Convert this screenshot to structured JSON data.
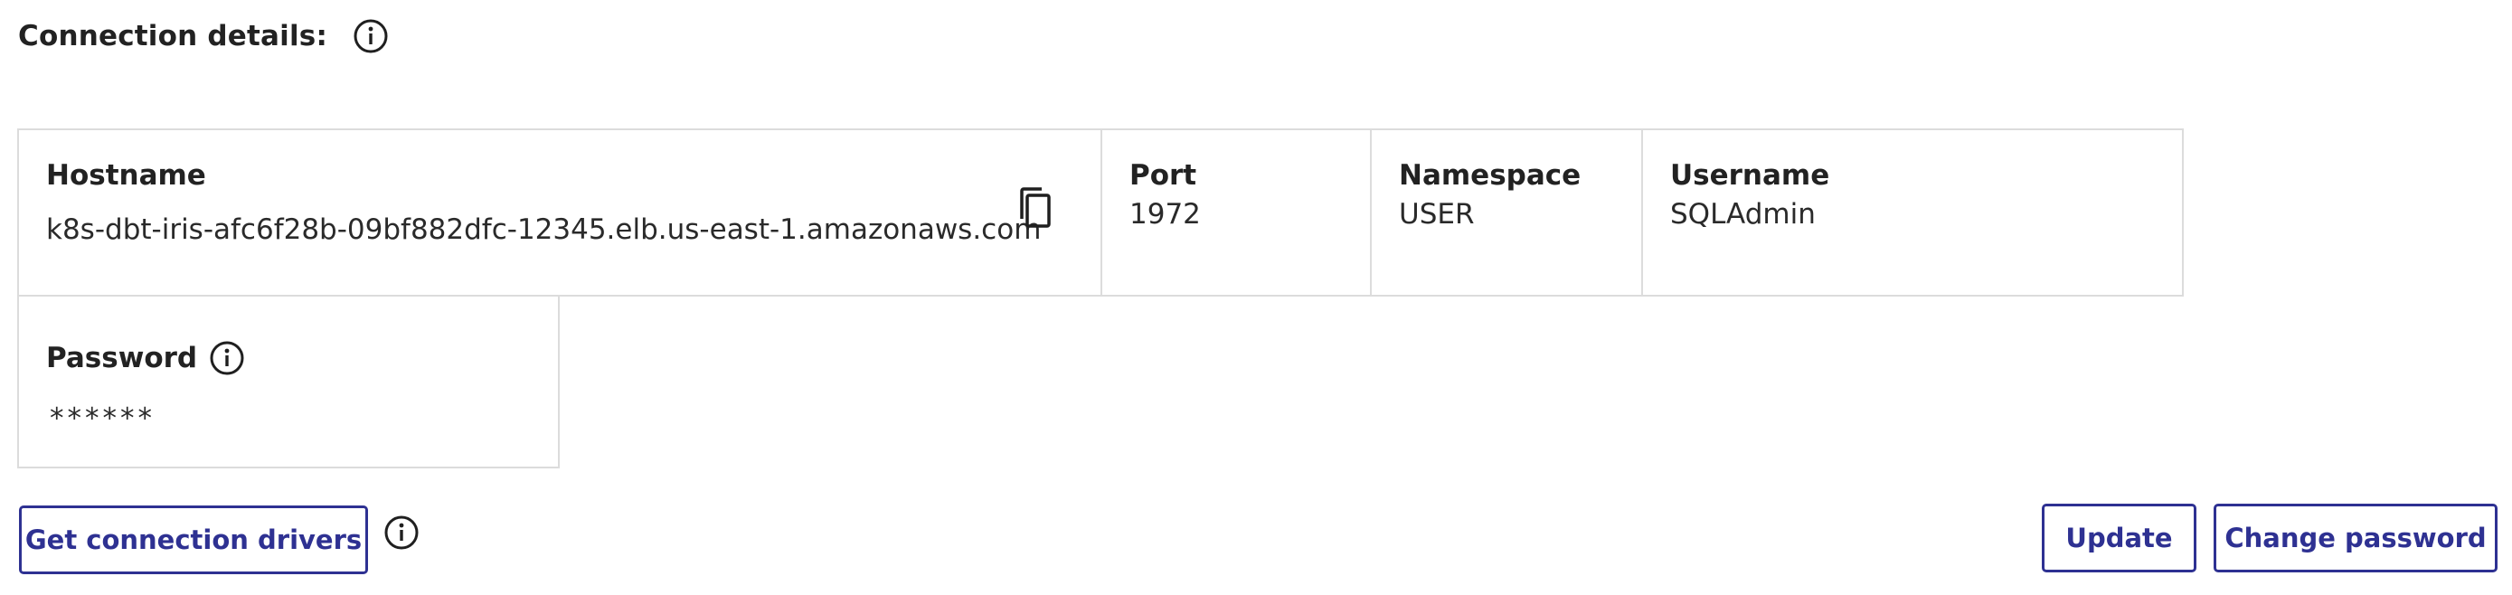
{
  "header": {
    "title": "Connection details:",
    "info_icon": "info-circle-icon"
  },
  "fields": {
    "hostname": {
      "label": "Hostname",
      "value": "k8s-dbt-iris-afc6f28b-09bf882dfc-12345.elb.us-east-1.amazonaws.com",
      "copy_icon": "copy-icon"
    },
    "port": {
      "label": "Port",
      "value": "1972"
    },
    "namespace": {
      "label": "Namespace",
      "value": "USER"
    },
    "username": {
      "label": "Username",
      "value": "SQLAdmin"
    },
    "password": {
      "label": "Password",
      "value": "******",
      "info_icon": "info-circle-icon"
    }
  },
  "actions": {
    "drivers_label": "Get connection drivers",
    "drivers_info_icon": "info-circle-icon",
    "update_label": "Update",
    "change_password_label": "Change password"
  },
  "colors": {
    "accent": "#2e3192",
    "border": "#dcdcdc",
    "text": "#222222"
  }
}
